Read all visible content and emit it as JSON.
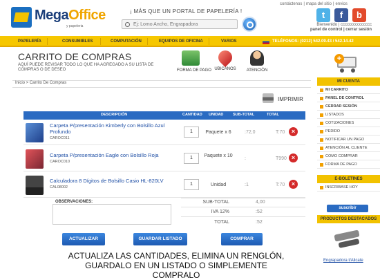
{
  "header": {
    "logo_name_1": "Mega",
    "logo_name_2": "Office",
    "logo_sub": "y papeleria",
    "tagline": "¡ MÁS QUE UN PORTAL DE PAPELERÍA !",
    "search_placeholder": "Ej: Lomo Ancho, Engrapadora",
    "top_links": [
      "contáctenos",
      "|",
      "mapa del sitio",
      "|",
      "envios"
    ],
    "welcome": "Bienvenido | ccccccccccccccc",
    "panel_link": "panel de control",
    "logout_link": "cerrar sesión",
    "social": {
      "twitter": "t",
      "facebook": "f",
      "youtube": "b"
    }
  },
  "nav": {
    "items": [
      "PAPELERÍA",
      "CONSUMIBLES",
      "COMPUTACIÓN",
      "EQUIPOS DE OFICINA",
      "VARIOS"
    ],
    "phone": "TELÉFONOS: (0212) 542.09.43 / 542.14.42"
  },
  "cart": {
    "title": "CARRITO DE COMPRAS",
    "subtitle": "AQUÍ PUEDE REVISAR TODO LO QUE HA AGREGADO A SU LISTA DE COMPRAS O DE DESEO",
    "icons": {
      "payment": "FORMA DE PAGO",
      "locations": "UBICANOS",
      "attention": "ATENCIÓN"
    },
    "breadcrumb": "Inicio > Carrito De Compras",
    "print_label": "IMPRIMIR"
  },
  "table": {
    "headers": [
      "DESCRIPCIÓN",
      "CANTIDAD",
      "UNIDAD",
      "SUB-TOTAL",
      "TOTAL"
    ],
    "rows": [
      {
        "name": "Carpeta P/presentación Kimberly con Bolsillo Azul Profundo",
        "code": "CAROC011",
        "qty": "1",
        "unit": "Paquete x 6",
        "subtotal": "​:72,0",
        "total": "T:70"
      },
      {
        "name": "Carpeta P/presentación Eagle con Bolsillo Roja",
        "code": "CAROC010",
        "qty": "1",
        "unit": "Paquete x 10",
        "subtotal": "​:​​",
        "total": "T990"
      },
      {
        "name": "Calculadora 8 Dígitos de Bolsillo Casio HL-820LV",
        "code": "CAL08002",
        "qty": "1",
        "unit": "Unidad",
        "subtotal": "​:1​​",
        "total": "T:70"
      }
    ]
  },
  "summary": {
    "observations_label": "OBSERVACIONES:",
    "subtotal_label": "SUB-TOTAL",
    "subtotal_value": "4,00",
    "iva_label": "IVA 12%",
    "iva_value": ":5​2",
    "total_label": "TOTAL",
    "total_value": ":​52"
  },
  "buttons": {
    "update": "ACTUALIZAR",
    "save": "GUARDAR LISTADO",
    "buy": "COMPRAR"
  },
  "hint": "ACTUALIZA LAS CANTIDADES, ELIMINA UN RENGLÓN, GUARDALO EN UN LISTADO O SIMPLEMENTE COMPRALO",
  "sidebar": {
    "account_title": "MI CUENTA",
    "account_items": [
      "MI CARRITO",
      "PANEL DE CONTROL",
      "CERRAR SESIÓN",
      "LISTADOS",
      "COTIZACIONES",
      "PEDIDO",
      "NOTIFICAR UN PAGO",
      "ATENCIÓN AL CLIENTE",
      "COMO COMPRAR",
      "FORMA DE PAGO"
    ],
    "newsletter_title": "E-BOLETINES",
    "newsletter_item": "INSCRIBASE HOY",
    "subscribe_label": "suscribir",
    "featured_title": "PRODUCTOS DESTACADOS",
    "featured_product": "Engrapadora t/Alicate"
  },
  "colors": {
    "accent": "#f6c700",
    "primary": "#2a6bc2",
    "delete": "#d42a2a"
  }
}
